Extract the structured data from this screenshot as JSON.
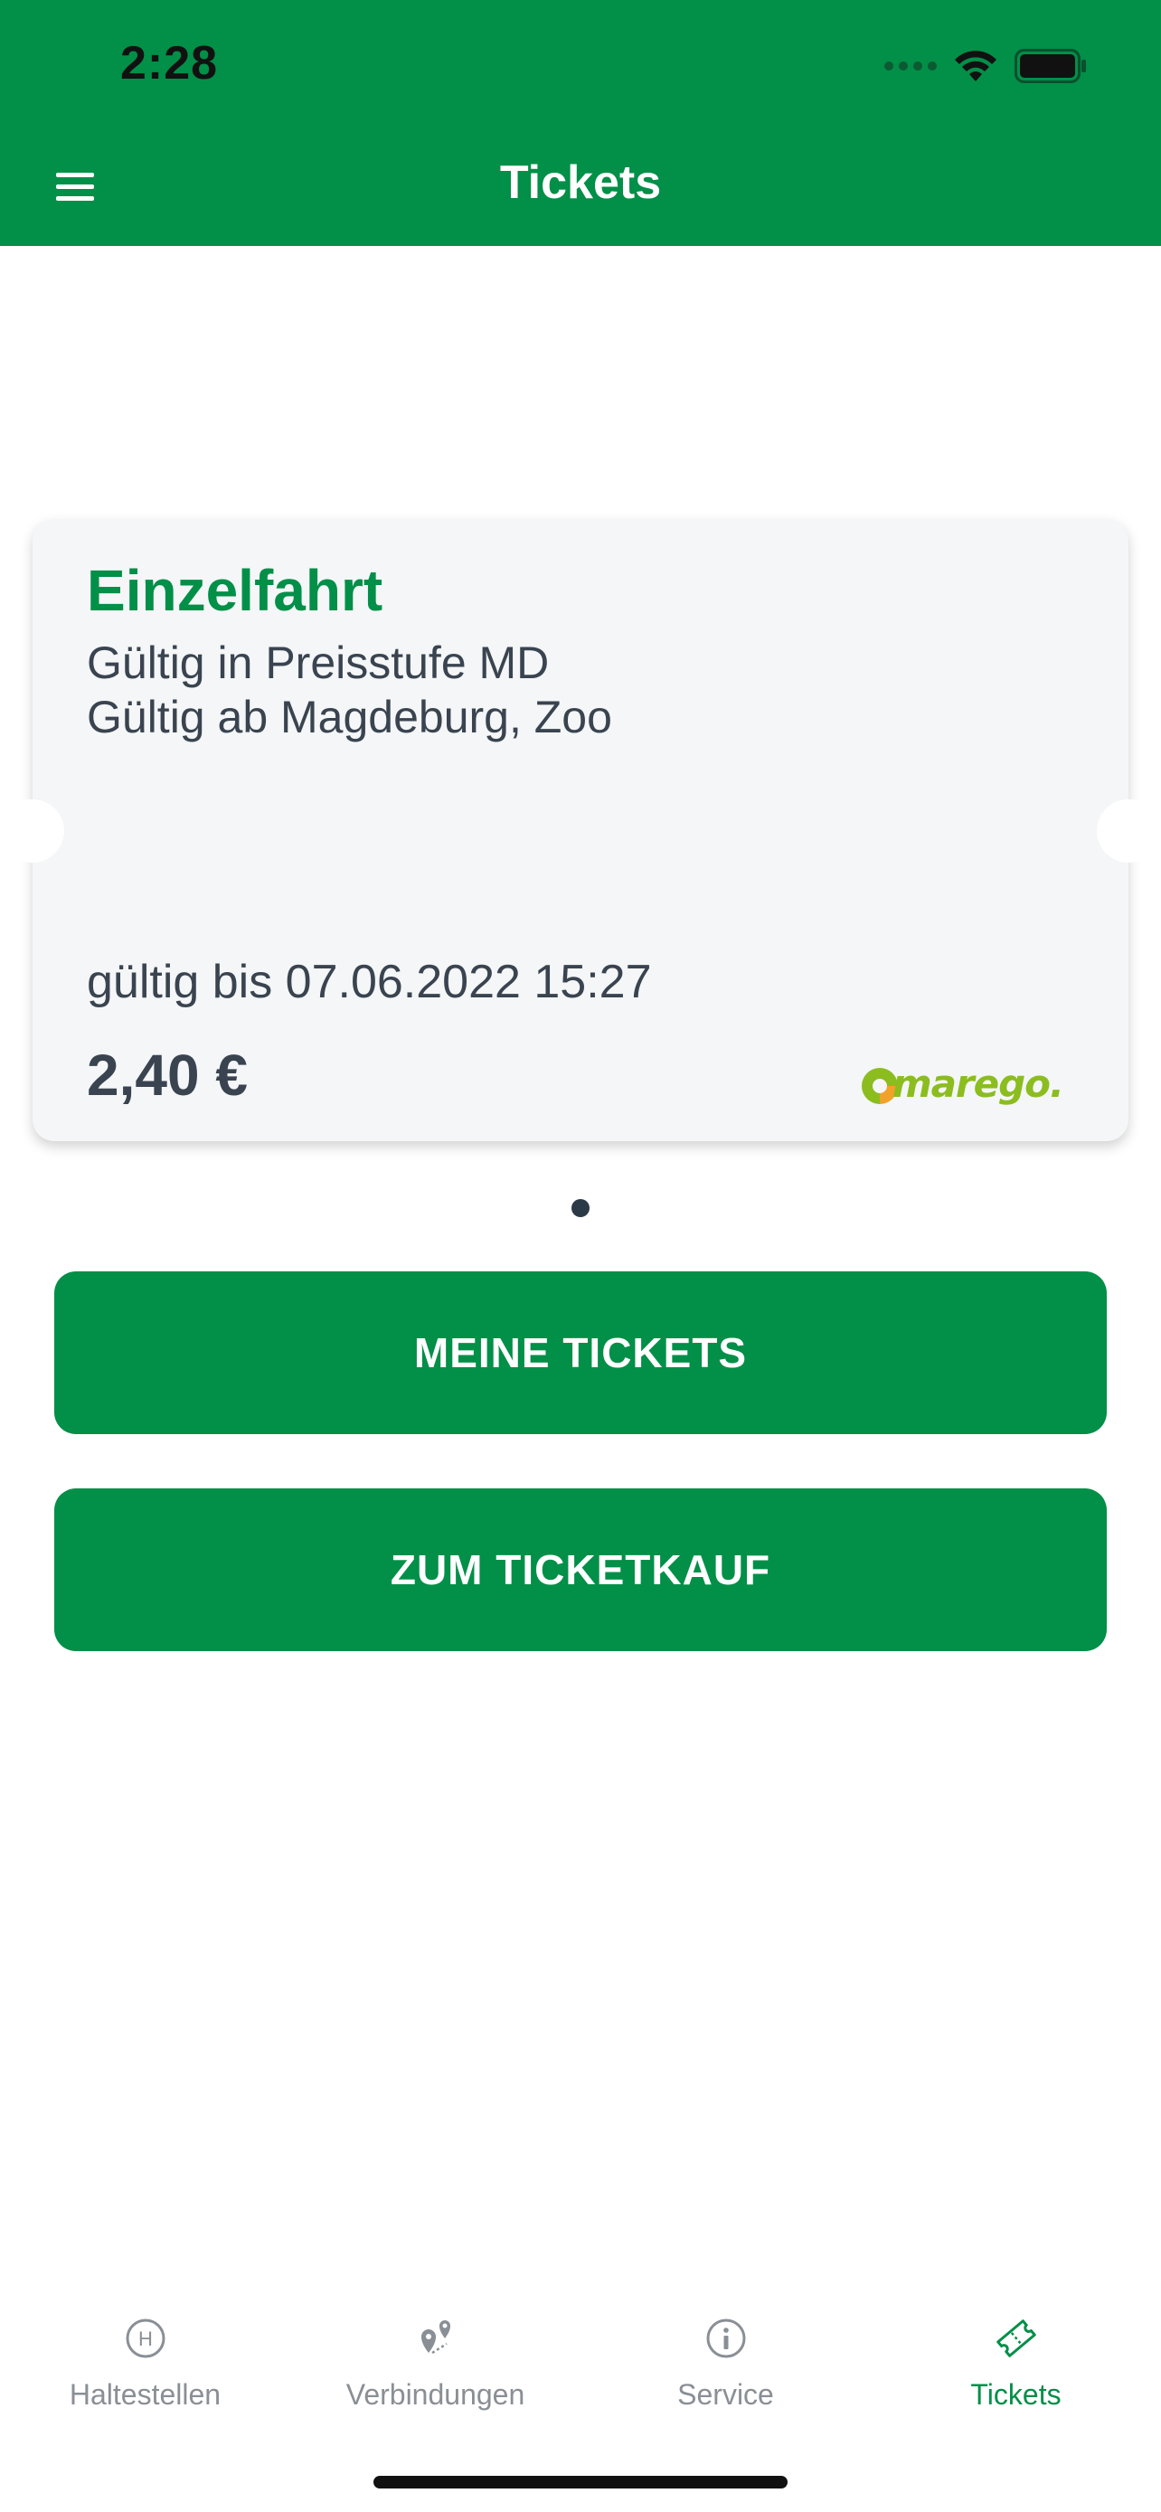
{
  "status_bar": {
    "time": "2:28"
  },
  "header": {
    "title": "Tickets",
    "menu_icon": "hamburger-menu-icon"
  },
  "ticket": {
    "name": "Einzelfahrt",
    "line1": "Gültig in Preisstufe MD",
    "line2": "Gültig ab Magdeburg, Zoo",
    "valid_until": "gültig bis 07.06.2022 15:27",
    "price": "2,40 €",
    "logo_text": "marego."
  },
  "pager": {
    "current": 1,
    "total": 1
  },
  "buttons": {
    "my_tickets": "MEINE TICKETS",
    "buy_ticket": "ZUM TICKETKAUF"
  },
  "tabs": [
    {
      "label": "Haltestellen",
      "icon": "stop-h-icon",
      "active": false
    },
    {
      "label": "Verbindungen",
      "icon": "route-icon",
      "active": false
    },
    {
      "label": "Service",
      "icon": "info-icon",
      "active": false
    },
    {
      "label": "Tickets",
      "icon": "ticket-icon",
      "active": true
    }
  ],
  "colors": {
    "brand_green": "#028f48",
    "text_dark": "#3a4450",
    "tab_inactive": "#8a8f96",
    "logo_green": "#8bbd1f",
    "logo_orange": "#f0a22a"
  }
}
